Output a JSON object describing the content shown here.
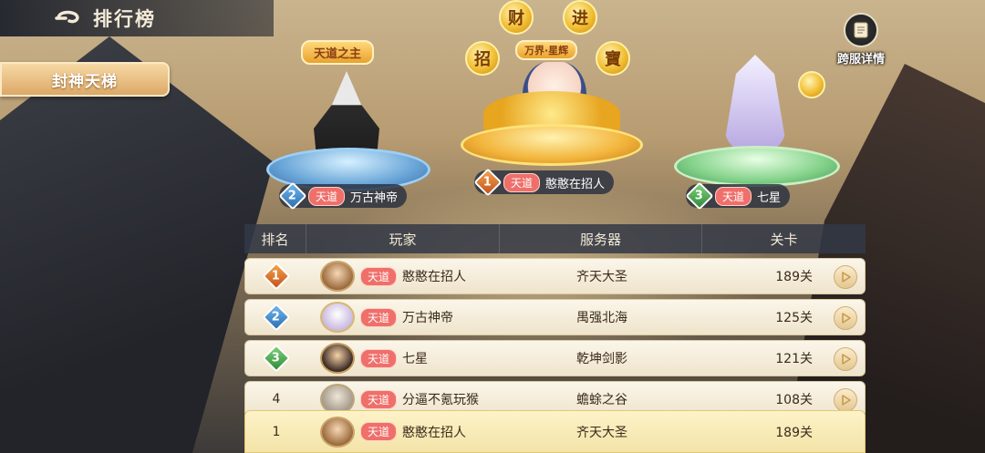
{
  "header": {
    "title": "排行榜"
  },
  "side_tab": {
    "label": "封神天梯"
  },
  "cross_server": {
    "label": "跨服详情"
  },
  "podium": {
    "first": {
      "rank": "1",
      "tag": "天道",
      "name": "憨憨在招人",
      "ribbon": "万界·星辉",
      "coins": [
        "招",
        "财",
        "进",
        "寶"
      ]
    },
    "second": {
      "rank": "2",
      "tag": "天道",
      "name": "万古神帝",
      "ribbon": "天道之主"
    },
    "third": {
      "rank": "3",
      "tag": "天道",
      "name": "七星"
    }
  },
  "table": {
    "headers": {
      "rank": "排名",
      "player": "玩家",
      "server": "服务器",
      "level": "关卡"
    },
    "rows": [
      {
        "rank": "1",
        "tag": "天道",
        "name": "憨憨在招人",
        "server": "齐天大圣",
        "level": "189关"
      },
      {
        "rank": "2",
        "tag": "天道",
        "name": "万古神帝",
        "server": "禺强北海",
        "level": "125关"
      },
      {
        "rank": "3",
        "tag": "天道",
        "name": "七星",
        "server": "乾坤剑影",
        "level": "121关"
      },
      {
        "rank": "4",
        "tag": "天道",
        "name": "分逼不氪玩猴",
        "server": "蟾蜍之谷",
        "level": "108关"
      }
    ]
  },
  "self_row": {
    "rank": "1",
    "tag": "天道",
    "name": "憨憨在招人",
    "server": "齐天大圣",
    "level": "189关"
  }
}
